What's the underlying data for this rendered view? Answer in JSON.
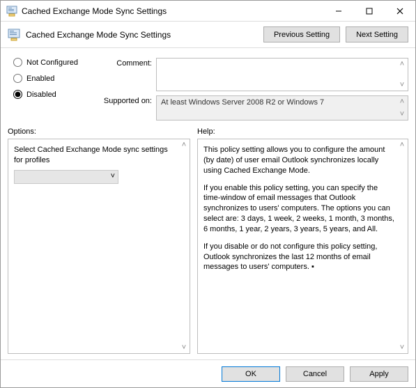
{
  "window": {
    "title": "Cached Exchange Mode Sync Settings"
  },
  "subheader": {
    "title": "Cached Exchange Mode Sync Settings",
    "previous": "Previous Setting",
    "next": "Next Setting"
  },
  "state": {
    "not_configured": "Not Configured",
    "enabled": "Enabled",
    "disabled": "Disabled",
    "selected": "disabled"
  },
  "fields": {
    "comment_label": "Comment:",
    "supported_label": "Supported on:",
    "supported_value": "At least Windows Server 2008 R2 or Windows 7"
  },
  "labels": {
    "options": "Options:",
    "help": "Help:"
  },
  "options": {
    "select_label": "Select Cached Exchange Mode sync settings for profiles"
  },
  "help": {
    "p1": "This policy setting allows you to configure the amount (by date) of user email Outlook synchronizes locally using Cached Exchange Mode.",
    "p2": "If you enable this policy setting, you can specify the time-window of email messages that Outlook synchronizes to users' computers. The options you can select are: 3 days, 1 week, 2 weeks, 1 month, 3 months, 6 months, 1 year, 2 years, 3 years, 5 years, and All.",
    "p3": "If you disable or do not configure this policy setting, Outlook synchronizes the last 12 months of email messages to users' computers.  ▪"
  },
  "buttons": {
    "ok": "OK",
    "cancel": "Cancel",
    "apply": "Apply"
  },
  "glyphs": {
    "chev_up": "˄",
    "chev_down": "˅",
    "chev_down_small": "˅"
  }
}
